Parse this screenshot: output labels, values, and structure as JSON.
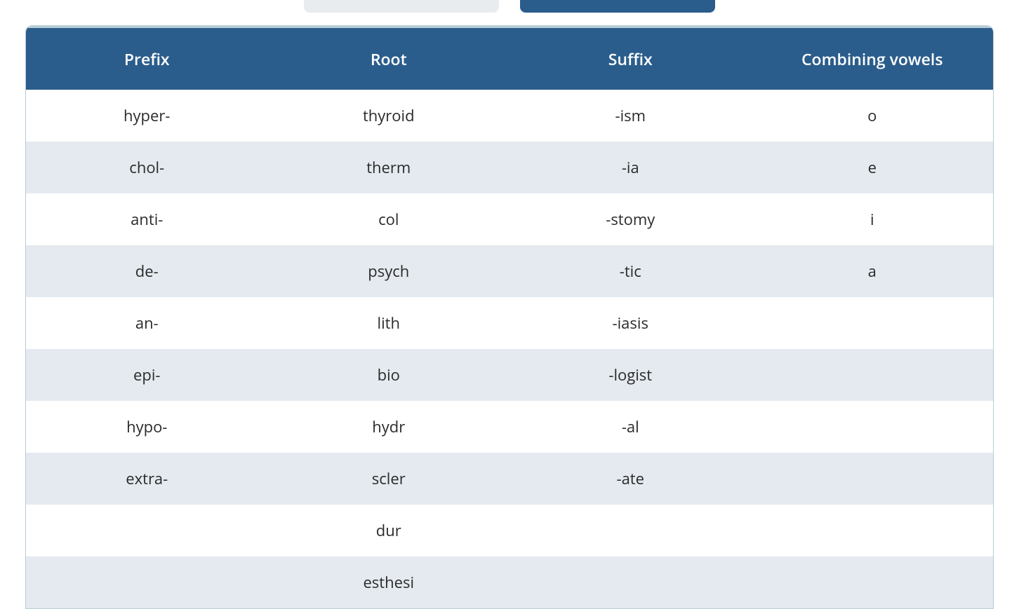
{
  "table": {
    "headers": [
      "Prefix",
      "Root",
      "Suffix",
      "Combining vowels"
    ],
    "rows": [
      {
        "prefix": "hyper-",
        "root": "thyroid",
        "suffix": "-ism",
        "vowel": "o"
      },
      {
        "prefix": "chol-",
        "root": "therm",
        "suffix": "-ia",
        "vowel": "e"
      },
      {
        "prefix": "anti-",
        "root": "col",
        "suffix": "-stomy",
        "vowel": "i"
      },
      {
        "prefix": "de-",
        "root": "psych",
        "suffix": "-tic",
        "vowel": "a"
      },
      {
        "prefix": "an-",
        "root": "lith",
        "suffix": "-iasis",
        "vowel": ""
      },
      {
        "prefix": "epi-",
        "root": "bio",
        "suffix": "-logist",
        "vowel": ""
      },
      {
        "prefix": "hypo-",
        "root": "hydr",
        "suffix": "-al",
        "vowel": ""
      },
      {
        "prefix": "extra-",
        "root": "scler",
        "suffix": "-ate",
        "vowel": ""
      },
      {
        "prefix": "",
        "root": "dur",
        "suffix": "",
        "vowel": ""
      },
      {
        "prefix": "",
        "root": "esthesi",
        "suffix": "",
        "vowel": ""
      }
    ]
  }
}
